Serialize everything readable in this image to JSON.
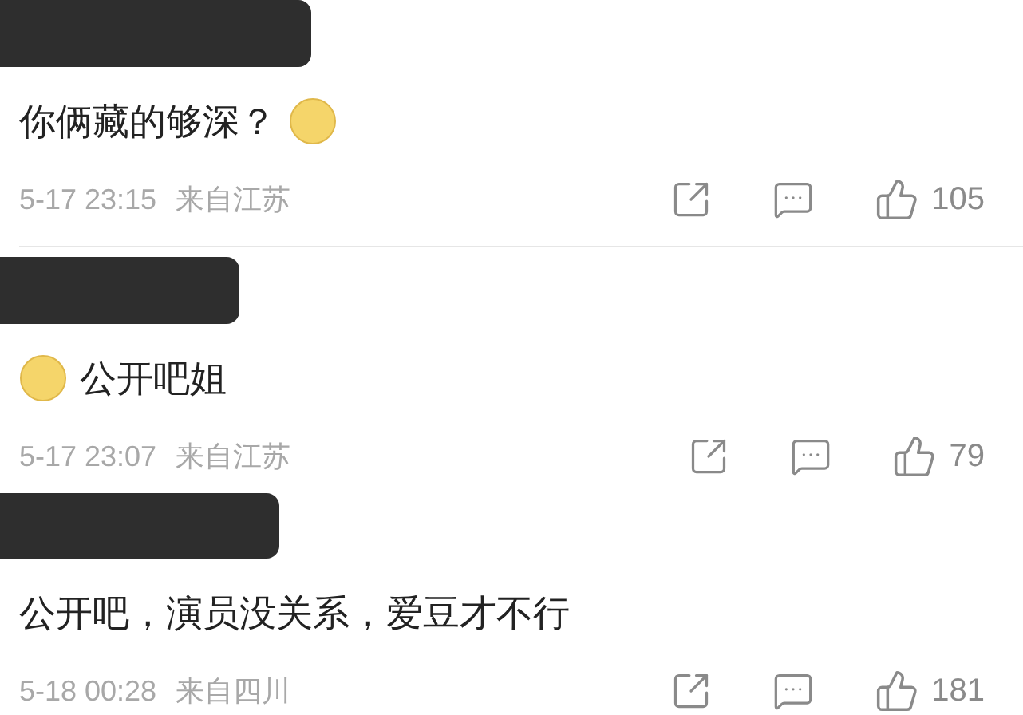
{
  "comments": [
    {
      "content": [
        {
          "kind": "text",
          "text": "你俩藏的够深？"
        },
        {
          "kind": "emoji"
        }
      ],
      "time": "5-17 23:15",
      "location": "来自江苏",
      "likes": "105",
      "divider": true
    },
    {
      "content": [
        {
          "kind": "emoji"
        },
        {
          "kind": "text",
          "text": "公开吧姐"
        }
      ],
      "time": "5-17 23:07",
      "location": "来自江苏",
      "likes": "79",
      "divider": false
    },
    {
      "content": [
        {
          "kind": "text",
          "text": "公开吧，演员没关系，爱豆才不行"
        }
      ],
      "time": "5-18 00:28",
      "location": "来自四川",
      "likes": "181",
      "divider": false
    }
  ]
}
